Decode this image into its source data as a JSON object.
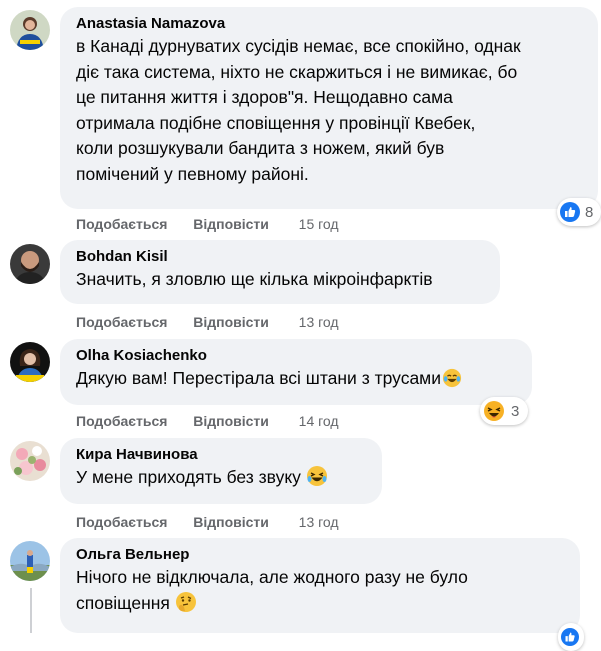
{
  "comments": [
    {
      "author": "Anastasia Namazova",
      "lines": [
        "в Канаді дурнуватих сусідів немає, все спокійно, однак",
        "діє така система, ніхто не скаржиться і не вимикає, бо",
        "це питання життя і здоров\"я. Нещодавно сама",
        "отримала подібне сповіщення у провінції Квебек,",
        "коли розшукували бандита з ножем, який був",
        "помічений у певному районі."
      ],
      "like_label": "Подобається",
      "reply_label": "Відповісти",
      "time": "15 год",
      "reaction_icon": "like-icon",
      "reaction_count": "8"
    },
    {
      "author": "Bohdan Kisil",
      "lines": [
        "Значить, я зловлю ще кілька мікроінфарктів"
      ],
      "like_label": "Подобається",
      "reply_label": "Відповісти",
      "time": "13 год"
    },
    {
      "author": "Olha Kosiachenko",
      "lines": [
        "Дякую вам! Перестірала всі штани з трусами"
      ],
      "like_label": "Подобається",
      "reply_label": "Відповісти",
      "time": "14 год",
      "inline_emoji": "crying-laughing-emoji",
      "reaction_icon": "haha-icon",
      "reaction_count": "3"
    },
    {
      "author": "Кира Начвинова",
      "lines": [
        "У мене приходять без звуку"
      ],
      "like_label": "Подобається",
      "reply_label": "Відповісти",
      "time": "13 год",
      "inline_emoji": "crying-laughing-emoji"
    },
    {
      "author": "Ольга Вельнер",
      "lines": [
        "Нічого не відключала, але жодного разу не було",
        "сповіщення"
      ],
      "inline_emoji": "thinking-face-emoji"
    }
  ],
  "colors": {
    "bubble": "#f0f2f5",
    "text": "#050505",
    "meta": "#65676b",
    "like_blue": "#1877f2",
    "haha_yellow": "#f7b125"
  }
}
